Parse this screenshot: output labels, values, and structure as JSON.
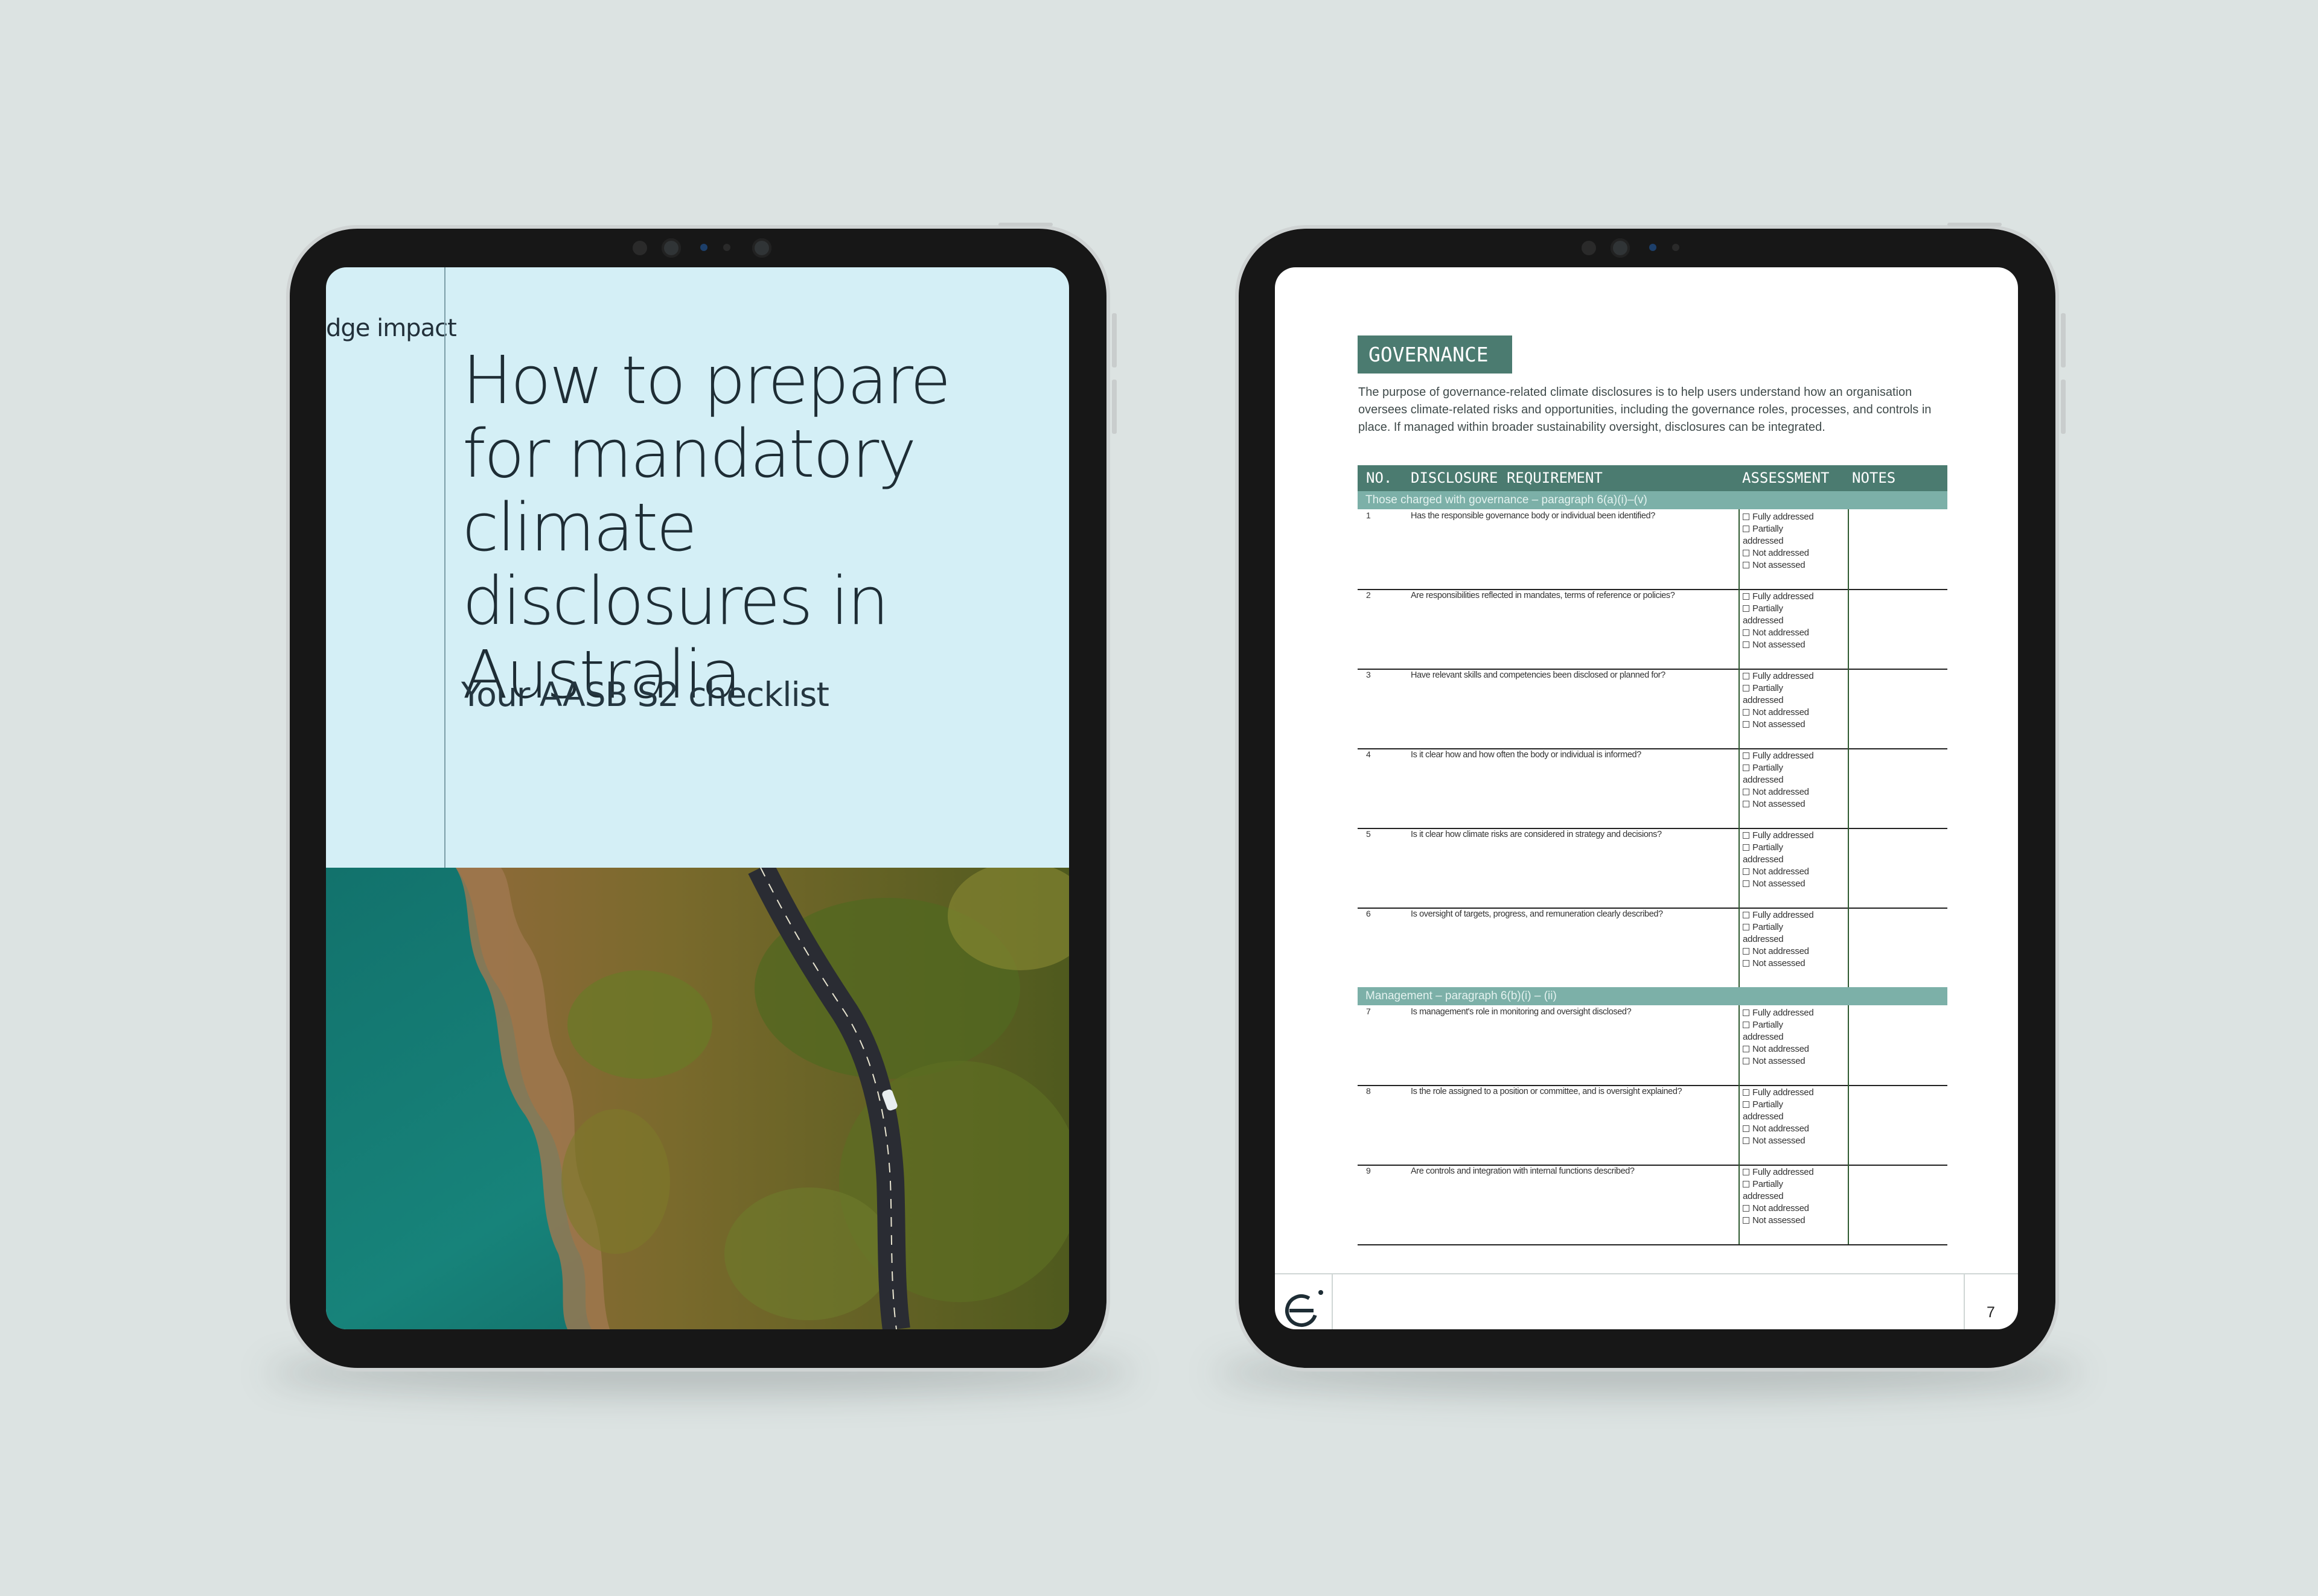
{
  "cover": {
    "logo_text": "dge impact",
    "title": "How to prepare for mandatory climate disclosures in Australia",
    "subtitle": "Your AASB S2 checklist",
    "photo": "aerial coastal road through bushland beside turquoise sea"
  },
  "checklist_page": {
    "heading": "GOVERNANCE",
    "intro": "The purpose of governance-related climate disclosures is to help users understand how an organisation oversees climate-related risks and opportunities, including the governance roles, processes, and controls in place. If managed within broader sustainability oversight, disclosures can be integrated.",
    "table_headers": {
      "no": "NO.",
      "requirement": "DISCLOSURE REQUIREMENT",
      "assessment": "ASSESSMENT",
      "notes": "NOTES"
    },
    "assessment_options": [
      "Fully addressed",
      "Partially addressed",
      "Not addressed",
      "Not assessed"
    ],
    "sections": [
      {
        "title": "Those charged with governance – paragraph 6(a)(i)–(v)",
        "rows": [
          {
            "no": "1",
            "question": "Has the responsible governance body or individual been identified?"
          },
          {
            "no": "2",
            "question": "Are responsibilities reflected in mandates, terms of reference or policies?"
          },
          {
            "no": "3",
            "question": "Have relevant skills and competencies been disclosed or planned for?"
          },
          {
            "no": "4",
            "question": "Is it clear how and how often the body or individual is informed?"
          },
          {
            "no": "5",
            "question": "Is it clear how climate risks are considered in strategy and decisions?"
          },
          {
            "no": "6",
            "question": "Is oversight of targets, progress, and remuneration clearly described?"
          }
        ]
      },
      {
        "title": "Management – paragraph 6(b)(i) – (ii)",
        "rows": [
          {
            "no": "7",
            "question": "Is management's role in monitoring and oversight disclosed?"
          },
          {
            "no": "8",
            "question": "Is the role assigned to a position or committee, and is oversight explained?"
          },
          {
            "no": "9",
            "question": "Are controls and integration with internal functions described?"
          }
        ]
      }
    ],
    "footer_logo": "e-logo-icon",
    "page_number": "7"
  },
  "colors": {
    "background": "#dce3e2",
    "cover_panel": "#d4eff6",
    "brand_green": "#4b7b70",
    "section_band": "#7cb0a8",
    "tablet_bezel": "#171717"
  }
}
